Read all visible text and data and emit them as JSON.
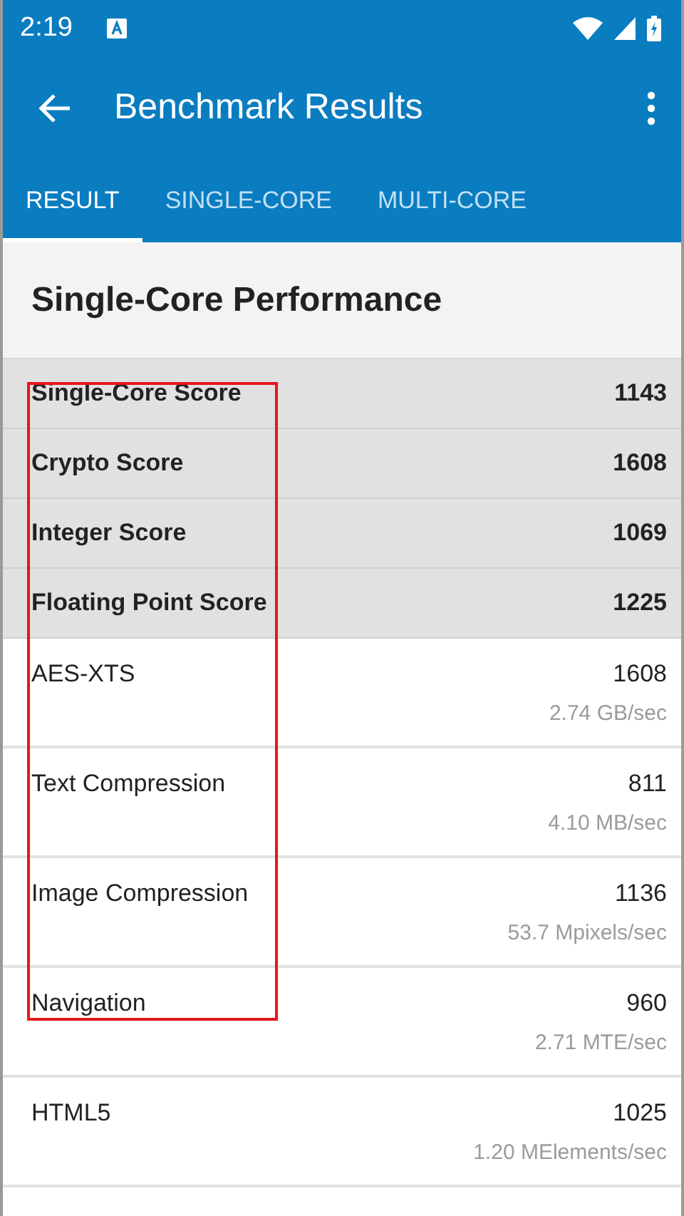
{
  "status_bar": {
    "time": "2:19"
  },
  "toolbar": {
    "title": "Benchmark Results"
  },
  "tabs": [
    {
      "label": "RESULT",
      "selected": true
    },
    {
      "label": "SINGLE-CORE",
      "selected": false
    },
    {
      "label": "MULTI-CORE",
      "selected": false
    }
  ],
  "section": {
    "title": "Single-Core Performance"
  },
  "rows": [
    {
      "kind": "summary",
      "name": "Single-Core Score",
      "score": "1143"
    },
    {
      "kind": "summary",
      "name": "Crypto Score",
      "score": "1608"
    },
    {
      "kind": "summary",
      "name": "Integer Score",
      "score": "1069"
    },
    {
      "kind": "summary",
      "name": "Floating Point Score",
      "score": "1225"
    },
    {
      "kind": "detail",
      "name": "AES-XTS",
      "score": "1608",
      "rate": "2.74 GB/sec"
    },
    {
      "kind": "detail",
      "name": "Text Compression",
      "score": "811",
      "rate": "4.10 MB/sec"
    },
    {
      "kind": "detail",
      "name": "Image Compression",
      "score": "1136",
      "rate": "53.7 Mpixels/sec"
    },
    {
      "kind": "detail",
      "name": "Navigation",
      "score": "960",
      "rate": "2.71 MTE/sec"
    },
    {
      "kind": "detail",
      "name": "HTML5",
      "score": "1025",
      "rate": "1.20 MElements/sec"
    }
  ]
}
